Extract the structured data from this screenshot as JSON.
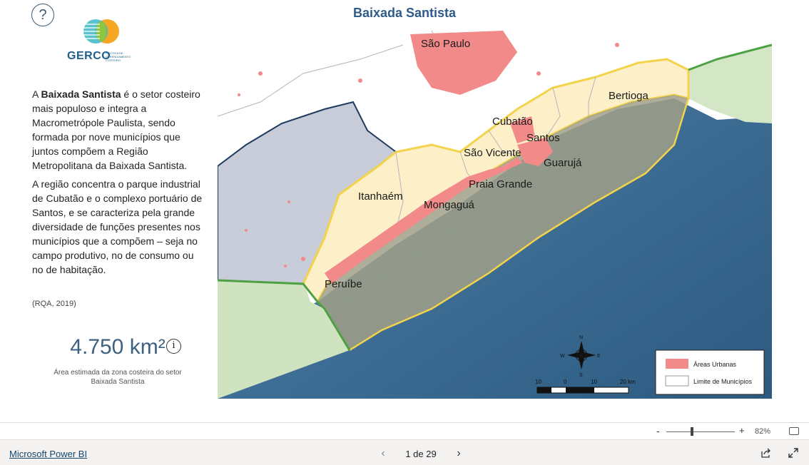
{
  "report": {
    "title": "Baixada Santista",
    "help_symbol": "?"
  },
  "logo": {
    "name": "GERCO",
    "subtitle": "POLÍTICA DE GERENCIAMENTO COSTEIRO"
  },
  "description": {
    "p1_prefix": "A ",
    "p1_bold": "Baixada Santista",
    "p1_rest": " é o setor costeiro mais populoso e integra a Macrometrópole Paulista, sendo formada por nove municípios que juntos compõem a Região Metropolitana da Baixada Santista.",
    "p2": "A região concentra o parque industrial de Cubatão e o complexo portuário de Santos, e se caracteriza pela grande diversidade de funções presentes nos municípios que a compõem – seja no campo produtivo, no de consumo ou no de habitação.",
    "reference": "(RQA, 2019)"
  },
  "kpi": {
    "value": "4.750 km²",
    "info_symbol": "i",
    "caption_line1": "Área estimada da zona costeira do setor",
    "caption_line2": "Baixada Santista"
  },
  "map": {
    "labels": {
      "sao_paulo": "São Paulo",
      "bertioga": "Bertioga",
      "cubatao": "Cubatão",
      "santos": "Santos",
      "sao_vicente": "São Vicente",
      "guaruja": "Guarujá",
      "praia_grande": "Praia Grande",
      "itanhaem": "Itanhaém",
      "mongagua": "Mongaguá",
      "peruibe": "Peruíbe"
    },
    "legend": {
      "urban": "Áreas Urbanas",
      "limits": "Limite de Municípios"
    },
    "scale": {
      "t1": "10",
      "t2": "0",
      "t3": "10",
      "t4": "20 km"
    },
    "compass": {
      "n": "N",
      "s": "S",
      "e": "E",
      "w": "W"
    },
    "colors": {
      "ocean_deep": "#2f5f86",
      "ocean_shallow": "#5b8fb0",
      "land": "#ffffff",
      "region": "#fdf1cc",
      "region_border": "#f3d34a",
      "coastal_zone": "#9c9c83",
      "urban": "#f28a8a",
      "neighbor": "#c7cbd8",
      "green": "#cfe3c1"
    }
  },
  "zoom": {
    "minus": "-",
    "plus": "+",
    "level": "82%"
  },
  "footer": {
    "link": "Microsoft Power BI",
    "page": "1 de 29",
    "prev": "‹",
    "next": "›"
  }
}
